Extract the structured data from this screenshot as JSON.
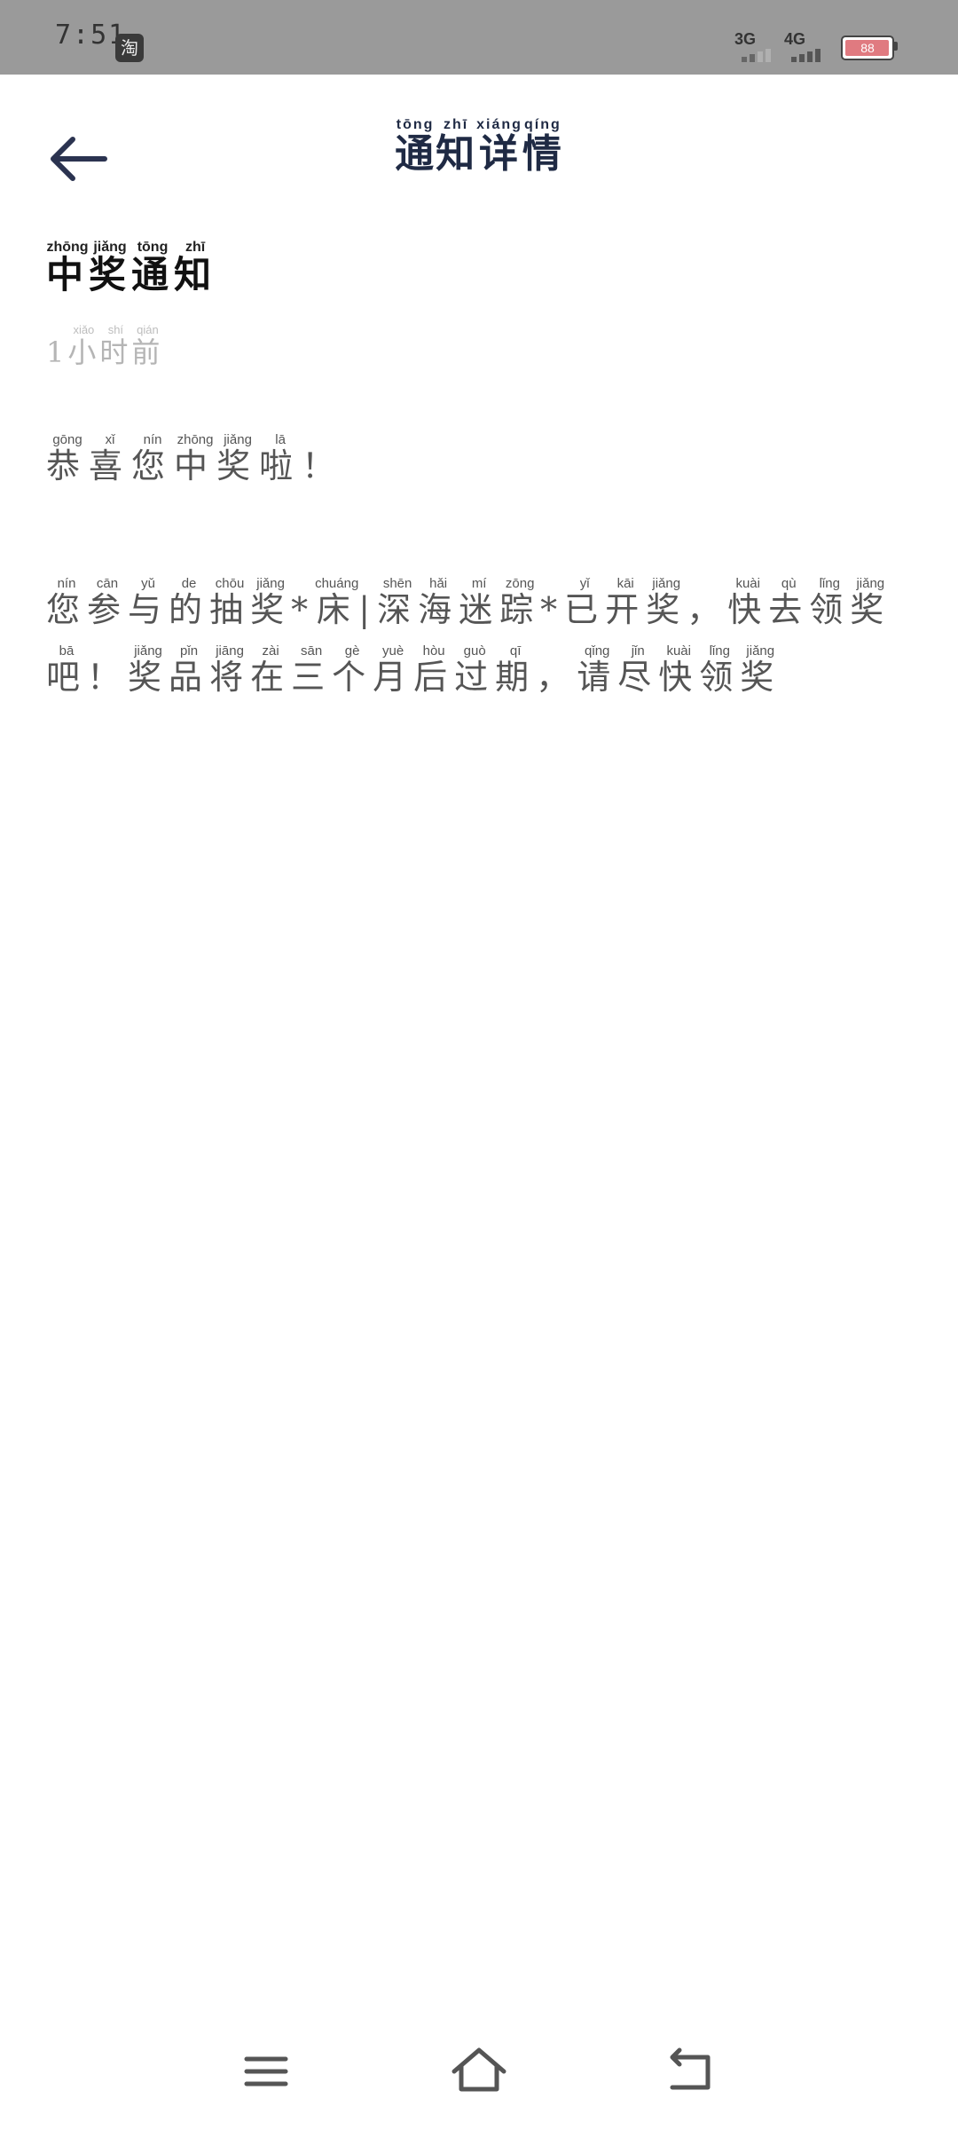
{
  "status_bar": {
    "time": "7:51",
    "app_icon_glyph": "淘",
    "network_1": "3G",
    "network_2": "4G",
    "battery_level": "88"
  },
  "header": {
    "title": [
      "通",
      "知",
      "详",
      "情"
    ],
    "title_pinyin": [
      "tōng",
      "zhī",
      "xiáng",
      "qíng"
    ],
    "back_icon": "arrow-left-icon"
  },
  "notice": {
    "heading": [
      "中",
      "奖",
      "通",
      "知"
    ],
    "heading_pinyin": [
      "zhōng",
      "jiǎng",
      "tōng",
      "zhī"
    ],
    "time_prefix": "1",
    "time_chars": [
      "小",
      "时",
      "前"
    ],
    "time_pinyin": [
      "xiǎo",
      "shí",
      "qián"
    ],
    "greeting": "恭喜您中奖啦！",
    "greeting_pinyin": [
      "gōng",
      "xǐ",
      "nín",
      "zhōng",
      "jiǎng",
      "lā",
      ""
    ],
    "body": "您参与的抽奖*床|深海迷踪*已开奖，快去领奖吧！奖品将在三个月后过期，请尽快领奖",
    "body_pinyin": [
      "nín",
      "cān",
      "yǔ",
      "de",
      "chōu",
      "jiǎng",
      "",
      "chuáng",
      "",
      "shēn",
      "hǎi",
      "mí",
      "zōng",
      "",
      "yǐ",
      "kāi",
      "jiǎng",
      "",
      "kuài",
      "qù",
      "lǐng",
      "jiǎng",
      "bā",
      "",
      "jiǎng",
      "pǐn",
      "jiāng",
      "zài",
      "sān",
      "gè",
      "yuè",
      "hòu",
      "guò",
      "qī",
      "",
      "qǐng",
      "jǐn",
      "kuài",
      "lǐng",
      "jiǎng"
    ]
  },
  "nav": {
    "menu_icon": "menu-icon",
    "home_icon": "home-icon",
    "back_icon": "back-icon"
  }
}
